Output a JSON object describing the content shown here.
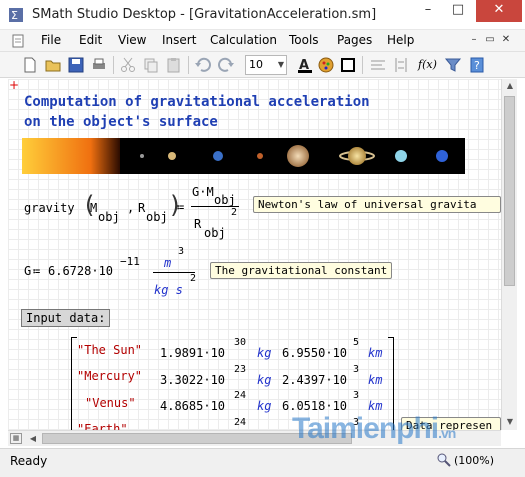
{
  "window": {
    "title": "SMath Studio Desktop - [GravitationAcceleration.sm]",
    "minimize": "–",
    "maximize": "□",
    "close": "✕"
  },
  "menu": [
    "File",
    "Edit",
    "View",
    "Insert",
    "Calculation",
    "Tools",
    "Pages",
    "Help"
  ],
  "mdi": {
    "minimize": "–",
    "restore": "▭",
    "close": "✕"
  },
  "toolbar": {
    "font_size": "10",
    "icons": [
      "new-icon",
      "open-icon",
      "save-icon",
      "print-icon",
      "cut-icon",
      "copy-icon",
      "paste-icon",
      "undo-icon",
      "redo-icon",
      "font-color-icon",
      "fill-color-icon",
      "border-icon",
      "align-icon",
      "insert-matrix-icon",
      "function-icon",
      "filter-icon",
      "help-icon"
    ],
    "function_label": "f(x)"
  },
  "worksheet": {
    "title_line1": "Computation of gravitational acceleration",
    "title_line2": "on the object's surface",
    "gravity": {
      "lhs": "gravity",
      "arg1": "M",
      "arg1_sub": "obj",
      "arg2": "R",
      "arg2_sub": "obj",
      "assign": "≔",
      "num": "G·M",
      "num_sub": "obj",
      "den": "R",
      "den_sub": "obj",
      "den_exp": "2",
      "comment": "Newton's law of universal gravita"
    },
    "constant": {
      "lhs": "G",
      "assign": "≔",
      "value": "6.6728·10",
      "exp": "−11",
      "unit_num": "m",
      "unit_num_exp": "3",
      "unit_den": "kg s",
      "unit_den_exp": "2",
      "comment": "The gravitational constant"
    },
    "input_label": "Input data:",
    "matrix_rows": [
      {
        "name": "\"The Sun\"",
        "mass": "1.9891·10",
        "mass_exp": "30",
        "mass_unit": "kg",
        "radius": "6.9550·10",
        "radius_exp": "5",
        "radius_unit": "km"
      },
      {
        "name": "\"Mercury\"",
        "mass": "3.3022·10",
        "mass_exp": "23",
        "mass_unit": "kg",
        "radius": "2.4397·10",
        "radius_exp": "3",
        "radius_unit": "km"
      },
      {
        "name": "\"Venus\"",
        "mass": "4.8685·10",
        "mass_exp": "24",
        "mass_unit": "kg",
        "radius": "6.0518·10",
        "radius_exp": "3",
        "radius_unit": "km"
      },
      {
        "name": "\"Earth\"",
        "mass": "",
        "mass_exp": "24",
        "mass_unit": "",
        "radius": "",
        "radius_exp": "3",
        "radius_unit": ""
      }
    ],
    "data_comment": "Data represen"
  },
  "status": {
    "text": "Ready",
    "zoom": "(100%)"
  },
  "watermark": {
    "text": "Taimienphi",
    "suffix": ".vn"
  }
}
